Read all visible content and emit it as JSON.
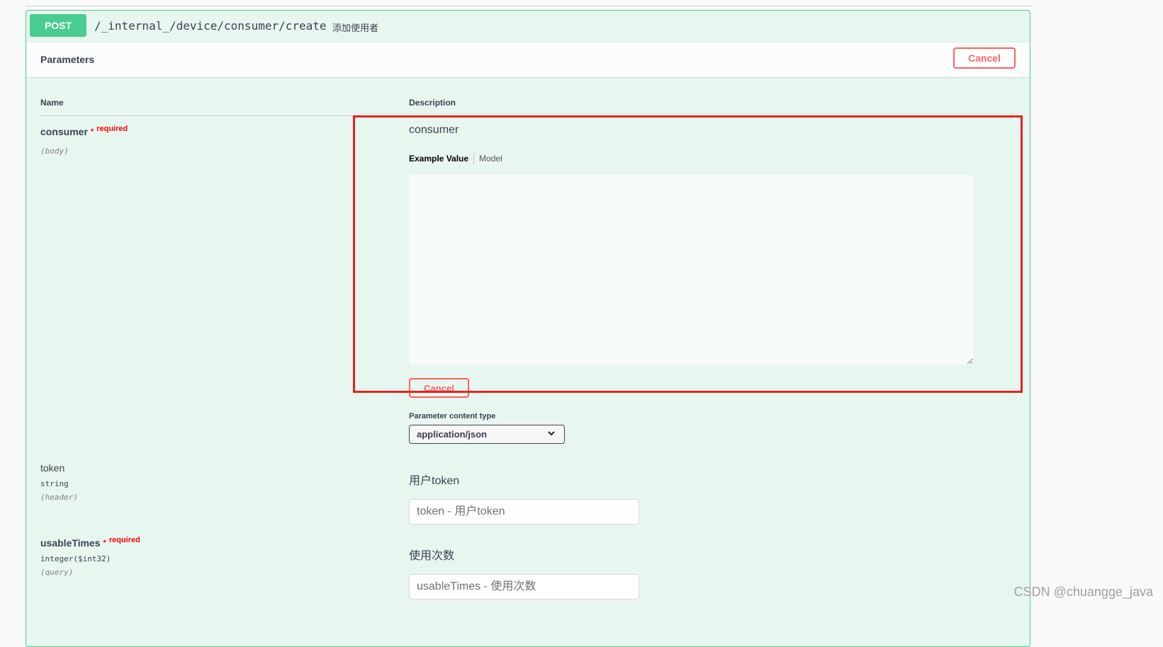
{
  "endpoint": {
    "method": "POST",
    "path": "/_internal_/device/consumer/create",
    "summary": "添加使用者"
  },
  "parameters_section": {
    "title": "Parameters",
    "cancel_label": "Cancel"
  },
  "table": {
    "name_header": "Name",
    "description_header": "Description"
  },
  "params": [
    {
      "name": "consumer",
      "required_star": "*",
      "required_label": "required",
      "in": "(body)",
      "description": "consumer",
      "example_tab": "Example Value",
      "model_tab": "Model",
      "body_value": "",
      "cancel_label": "Cancel",
      "content_type_label": "Parameter content type",
      "content_type_value": "application/json"
    },
    {
      "name": "token",
      "type": "string",
      "in": "(header)",
      "description": "用户token",
      "placeholder": "token - 用户token"
    },
    {
      "name": "usableTimes",
      "required_star": "*",
      "required_label": "required",
      "type": "integer($int32)",
      "in": "(query)",
      "description": "使用次数",
      "placeholder": "usableTimes - 使用次数"
    }
  ],
  "icons": {
    "select_chevron": "chevron-down-icon"
  },
  "colors": {
    "post_green": "#49cc90",
    "cancel_red": "#ff6060",
    "highlight_red": "#e82121",
    "required_red": "#ff0000"
  },
  "watermark": "CSDN @chuangge_java"
}
